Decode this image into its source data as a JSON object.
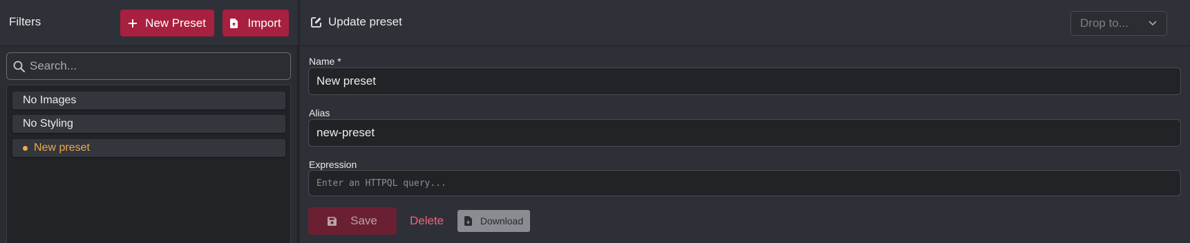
{
  "filters_panel": {
    "title": "Filters",
    "new_preset_label": "New Preset",
    "import_label": "Import",
    "search": {
      "placeholder": "Search...",
      "value": ""
    },
    "presets": [
      {
        "label": "No Images",
        "active": false
      },
      {
        "label": "No Styling",
        "active": false
      },
      {
        "label": "New preset",
        "active": true
      }
    ]
  },
  "editor": {
    "title": "Update preset",
    "drop_to": {
      "placeholder": "Drop to..."
    },
    "name": {
      "label": "Name *",
      "value": "New preset"
    },
    "alias": {
      "label": "Alias",
      "value": "new-preset"
    },
    "expression": {
      "label": "Expression",
      "placeholder": "Enter an HTTPQL query...",
      "value": ""
    },
    "save_label": "Save",
    "delete_label": "Delete",
    "download_label": "Download"
  },
  "icons": {
    "plus": "plus-icon",
    "import": "file-import-icon",
    "search": "search-icon",
    "edit": "edit-icon",
    "chevron": "chevron-down-icon",
    "save": "save-icon",
    "download": "file-download-icon"
  },
  "colors": {
    "accent": "#a8203f",
    "active_preset": "#f0a94a",
    "delete": "#e8677d"
  }
}
